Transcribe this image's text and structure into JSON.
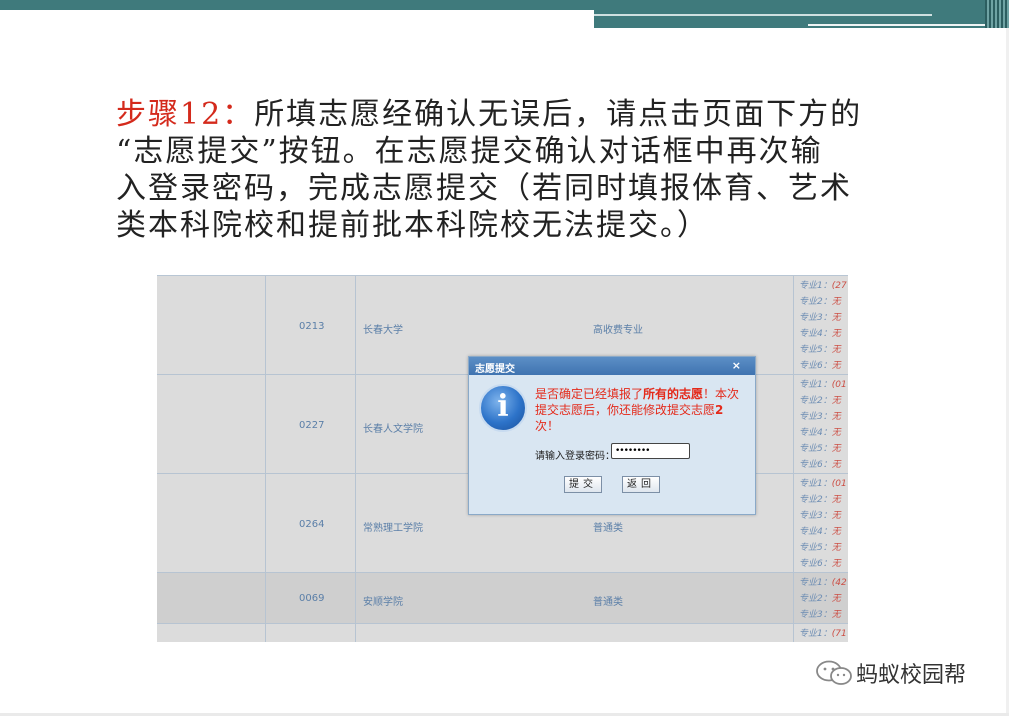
{
  "instruction": {
    "step_label": "步骤12：",
    "line1_rest": "所填志愿经确认无误后，请点击页面下方的",
    "line2": "“志愿提交”按钮。在志愿提交确认对话框中再次输",
    "line3": "入登录密码，完成志愿提交（若同时填报体育、艺术",
    "line4": "类本科院校和提前批本科院校无法提交。）"
  },
  "table": {
    "rows": [
      {
        "code": "0213",
        "school": "长春大学",
        "type": "高收费专业",
        "majors": [
          {
            "label": "专业1：",
            "value": "(27"
          },
          {
            "label": "专业2：",
            "value": "无"
          },
          {
            "label": "专业3：",
            "value": "无"
          },
          {
            "label": "专业4：",
            "value": "无"
          },
          {
            "label": "专业5：",
            "value": "无"
          },
          {
            "label": "专业6：",
            "value": "无"
          }
        ]
      },
      {
        "code": "0227",
        "school": "长春人文学院",
        "type": "",
        "majors": [
          {
            "label": "专业1：",
            "value": "(01"
          },
          {
            "label": "专业2：",
            "value": "无"
          },
          {
            "label": "专业3：",
            "value": "无"
          },
          {
            "label": "专业4：",
            "value": "无"
          },
          {
            "label": "专业5：",
            "value": "无"
          },
          {
            "label": "专业6：",
            "value": "无"
          }
        ]
      },
      {
        "code": "0264",
        "school": "常熟理工学院",
        "type": "普通类",
        "majors": [
          {
            "label": "专业1：",
            "value": "(01"
          },
          {
            "label": "专业2：",
            "value": "无"
          },
          {
            "label": "专业3：",
            "value": "无"
          },
          {
            "label": "专业4：",
            "value": "无"
          },
          {
            "label": "专业5：",
            "value": "无"
          },
          {
            "label": "专业6：",
            "value": "无"
          }
        ]
      },
      {
        "code": "0069",
        "school": "安顺学院",
        "type": "普通类",
        "majors": [
          {
            "label": "专业1：",
            "value": "(42"
          },
          {
            "label": "专业2：",
            "value": "无"
          },
          {
            "label": "专业3：",
            "value": "无"
          }
        ]
      },
      {
        "code": "",
        "school": "",
        "type": "",
        "majors": [
          {
            "label": "专业1：",
            "value": "(71"
          }
        ]
      }
    ]
  },
  "dialog": {
    "title": "志愿提交",
    "close": "×",
    "msg_part1": "是否确定已经填报了",
    "msg_bold1": "所有的志愿",
    "msg_part2": "！本次提交志愿后，你还能修改提交志愿",
    "msg_bold2": "2",
    "msg_part3": "次！",
    "password_label": "请输入登录密码：",
    "password_value": "••••••••",
    "submit_label": "提交",
    "back_label": "返回"
  },
  "watermark": {
    "text": "蚂蚁校园帮"
  }
}
